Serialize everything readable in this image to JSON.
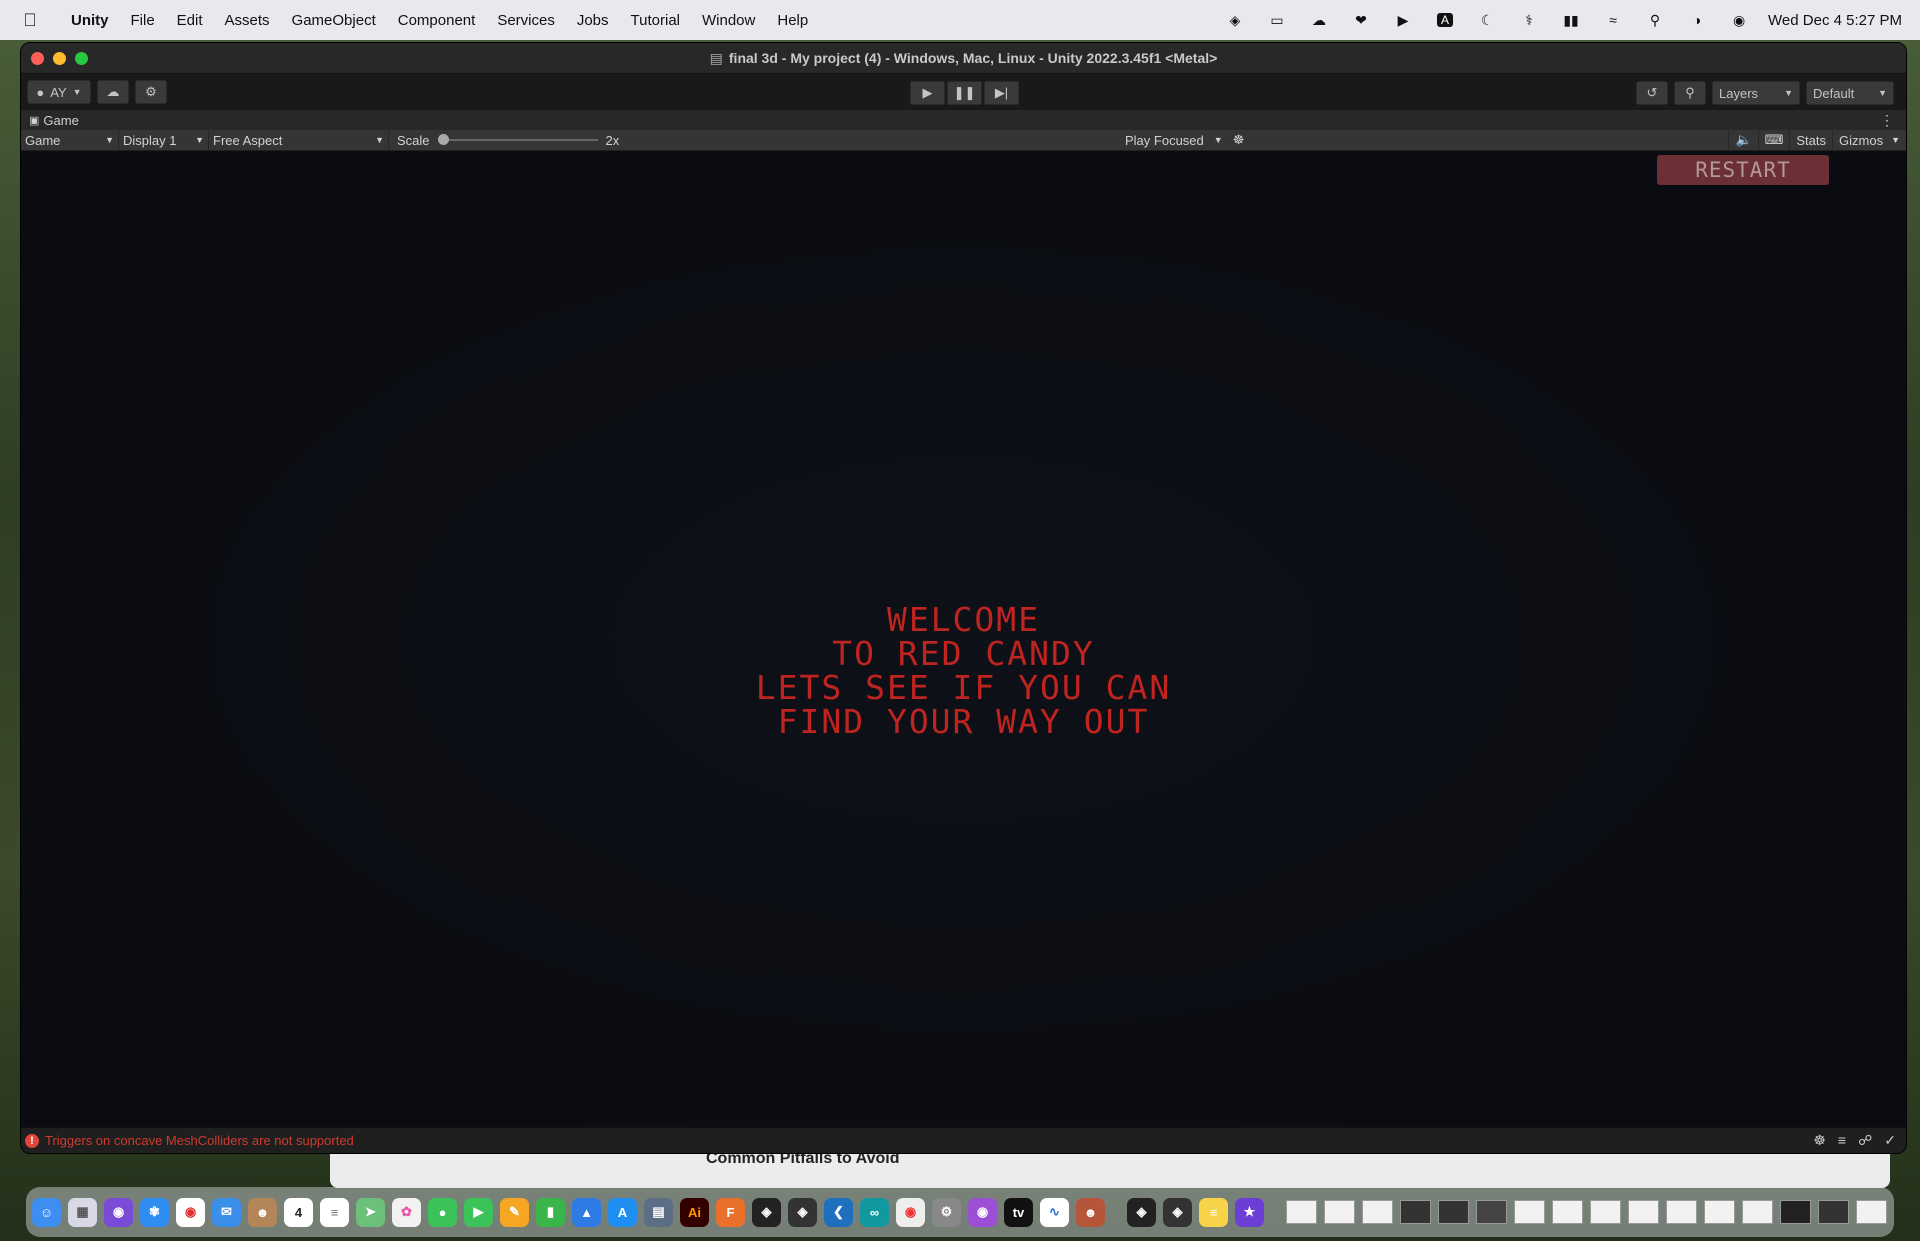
{
  "menubar": {
    "app_name": "Unity",
    "items": [
      "File",
      "Edit",
      "Assets",
      "GameObject",
      "Component",
      "Services",
      "Jobs",
      "Tutorial",
      "Window",
      "Help"
    ],
    "clock": "Wed Dec 4  5:27 PM",
    "status_icons": [
      "unity-icon",
      "display-icon",
      "creative-cloud-icon",
      "app-icon",
      "play-circle-icon",
      "input-source-icon",
      "moon-icon",
      "airpods-icon",
      "battery-icon",
      "wifi-icon",
      "search-icon",
      "control-center-icon",
      "siri-icon"
    ],
    "input_source": "A"
  },
  "window": {
    "title": "final 3d - My project (4) - Windows, Mac, Linux - Unity 2022.3.45f1 <Metal>"
  },
  "toolbar": {
    "account_label": "AY",
    "layers_label": "Layers",
    "layout_label": "Default"
  },
  "game_tab": {
    "label": "Game"
  },
  "game_bar": {
    "view_select": "Game",
    "display_select": "Display 1",
    "aspect_select": "Free Aspect",
    "scale_label": "Scale",
    "scale_value": "2x",
    "scale_fraction": 0.0,
    "play_mode": "Play Focused",
    "stats_label": "Stats",
    "gizmos_label": "Gizmos"
  },
  "game": {
    "restart_label": "RESTART",
    "welcome_text": "WELCOME\nTO RED CANDY",
    "challenge_text": "LETS SEE IF YOU CAN\nFIND YOUR WAY OUT",
    "text_color": "#c02420",
    "restart_bg": "#6b2f36"
  },
  "status": {
    "message": "Triggers on concave MeshColliders are not supported"
  },
  "background_app": {
    "heading": "Common Pitfalls to Avoid"
  },
  "dock": {
    "calendar_day": "4"
  }
}
